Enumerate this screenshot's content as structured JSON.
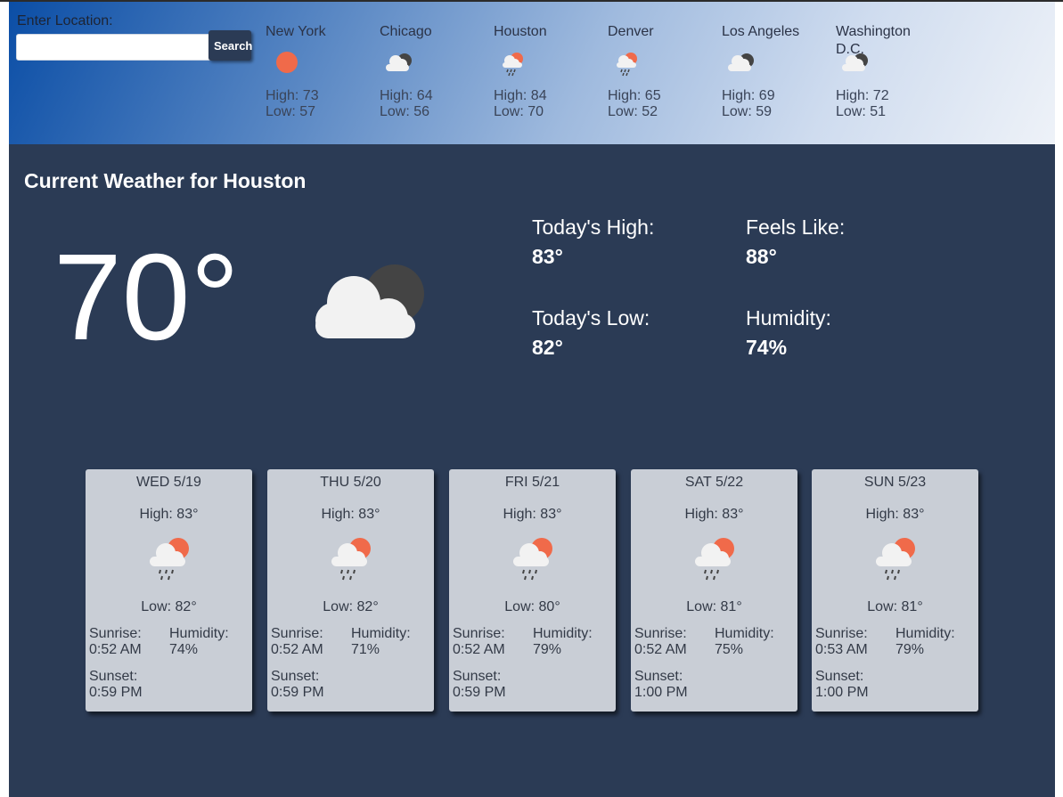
{
  "search": {
    "label": "Enter Location:",
    "value": "",
    "placeholder": "",
    "button": "Search"
  },
  "cities": [
    {
      "name": "New York",
      "icon": "sunny-icon",
      "high": "High: 73",
      "low": "Low: 57"
    },
    {
      "name": "Chicago",
      "icon": "cloudy-night-icon",
      "high": "High: 64",
      "low": "Low: 56"
    },
    {
      "name": "Houston",
      "icon": "rain-sun-icon",
      "high": "High: 84",
      "low": "Low: 70"
    },
    {
      "name": "Denver",
      "icon": "rain-sun-icon",
      "high": "High: 65",
      "low": "Low: 52"
    },
    {
      "name": "Los Angeles",
      "icon": "cloudy-night-icon",
      "high": "High: 69",
      "low": "Low: 59"
    },
    {
      "name": "Washington D.C.",
      "icon": "cloudy-night-icon",
      "high": "High: 72",
      "low": "Low: 51"
    }
  ],
  "current": {
    "title": "Current Weather for Houston",
    "temperature": "70°",
    "icon": "cloudy-night-icon",
    "high_label": "Today's High:",
    "high_value": "83°",
    "low_label": "Today's Low:",
    "low_value": "82°",
    "feels_label": "Feels Like:",
    "feels_value": "88°",
    "humidity_label": "Humidity:",
    "humidity_value": "74%"
  },
  "forecast": [
    {
      "day": "WED 5/19",
      "high": "High: 83°",
      "low": "Low: 82°",
      "icon": "rain-sun-icon",
      "sunrise_label": "Sunrise:",
      "sunrise": "0:52 AM",
      "humidity_label": "Humidity:",
      "humidity": "74%",
      "sunset_label": "Sunset:",
      "sunset": "0:59 PM"
    },
    {
      "day": "THU 5/20",
      "high": "High: 83°",
      "low": "Low: 82°",
      "icon": "rain-sun-icon",
      "sunrise_label": "Sunrise:",
      "sunrise": "0:52 AM",
      "humidity_label": "Humidity:",
      "humidity": "71%",
      "sunset_label": "Sunset:",
      "sunset": "0:59 PM"
    },
    {
      "day": "FRI 5/21",
      "high": "High: 83°",
      "low": "Low: 80°",
      "icon": "rain-sun-icon",
      "sunrise_label": "Sunrise:",
      "sunrise": "0:52 AM",
      "humidity_label": "Humidity:",
      "humidity": "79%",
      "sunset_label": "Sunset:",
      "sunset": "0:59 PM"
    },
    {
      "day": "SAT 5/22",
      "high": "High: 83°",
      "low": "Low: 81°",
      "icon": "rain-sun-icon",
      "sunrise_label": "Sunrise:",
      "sunrise": "0:52 AM",
      "humidity_label": "Humidity:",
      "humidity": "75%",
      "sunset_label": "Sunset:",
      "sunset": "1:00 PM"
    },
    {
      "day": "SUN 5/23",
      "high": "High: 83°",
      "low": "Low: 81°",
      "icon": "rain-sun-icon",
      "sunrise_label": "Sunrise:",
      "sunrise": "0:53 AM",
      "humidity_label": "Humidity:",
      "humidity": "79%",
      "sunset_label": "Sunset:",
      "sunset": "1:00 PM"
    }
  ],
  "colors": {
    "background": "#2b3b55",
    "card": "#c9ced6",
    "sun": "#f06a4a",
    "cloud": "#f2f2f2",
    "moon": "#444444"
  }
}
